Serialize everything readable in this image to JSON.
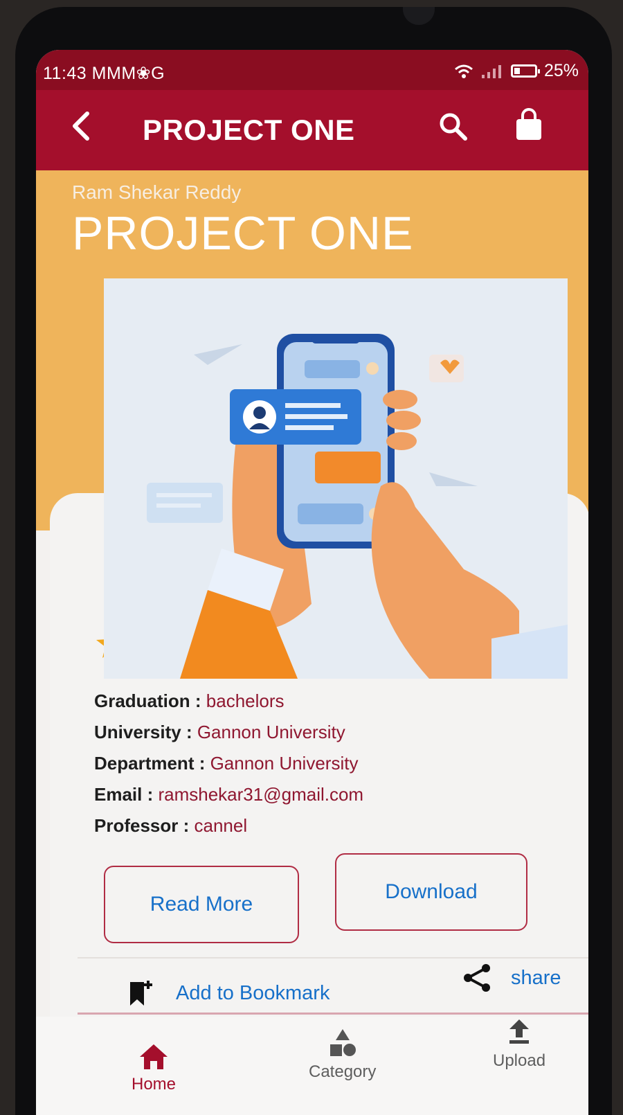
{
  "status_bar": {
    "time": "11:43",
    "notifications": "MMM❀G",
    "battery": "25%"
  },
  "app_bar": {
    "title": "PROJECT ONE"
  },
  "project": {
    "author": "Ram Shekar Reddy",
    "title": "PROJECT ONE"
  },
  "details": [
    {
      "label": "Graduation : ",
      "value": "bachelors"
    },
    {
      "label": "University : ",
      "value": "Gannon University"
    },
    {
      "label": "Department : ",
      "value": "Gannon University"
    },
    {
      "label": "Email : ",
      "value": "ramshekar31@gmail.com"
    },
    {
      "label": "Professor : ",
      "value": "cannel"
    }
  ],
  "actions": {
    "read_more": "Read More",
    "download": "Download",
    "bookmark": "Add to Bookmark",
    "share": "share"
  },
  "bottom_nav": [
    {
      "label": "Home",
      "icon": "home-icon",
      "active": true
    },
    {
      "label": "Category",
      "icon": "category-icon",
      "active": false
    },
    {
      "label": "Upload",
      "icon": "upload-icon",
      "active": false
    }
  ],
  "colors": {
    "primary": "#a40f2c",
    "header_band": "#efb45b",
    "link": "#1770c9"
  }
}
